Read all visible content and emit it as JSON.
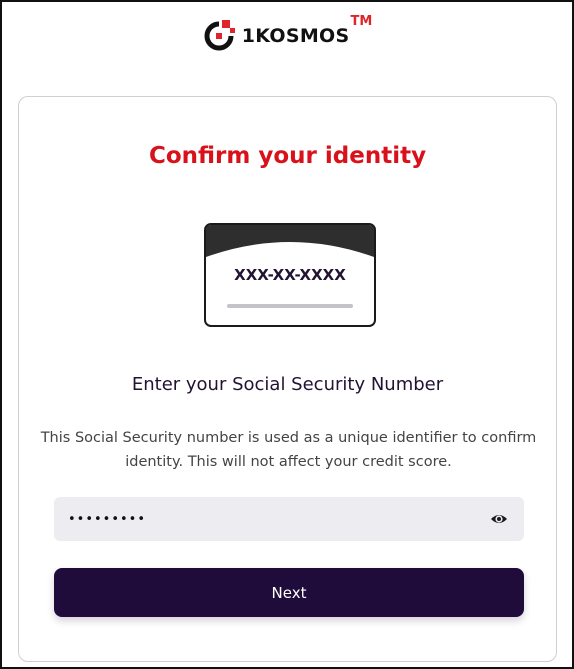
{
  "brand": {
    "name": "1KOSMOS",
    "trademark": "TM",
    "logo_icon": "1kosmos-logo-icon",
    "colors": {
      "accent_red": "#d8111a",
      "dark_purple": "#200c3a"
    }
  },
  "card": {
    "title": "Confirm your identity",
    "illustration": {
      "icon": "ssn-card-icon",
      "mask_text": "XXX-XX-XXXX"
    },
    "subtitle": "Enter your Social Security Number",
    "description": "This Social Security number is used as a unique identifier to confirm identity. This will not affect your credit score.",
    "ssn_field": {
      "value": "•••••••••",
      "type": "password",
      "toggle_icon": "eye-icon"
    },
    "next_button_label": "Next"
  }
}
